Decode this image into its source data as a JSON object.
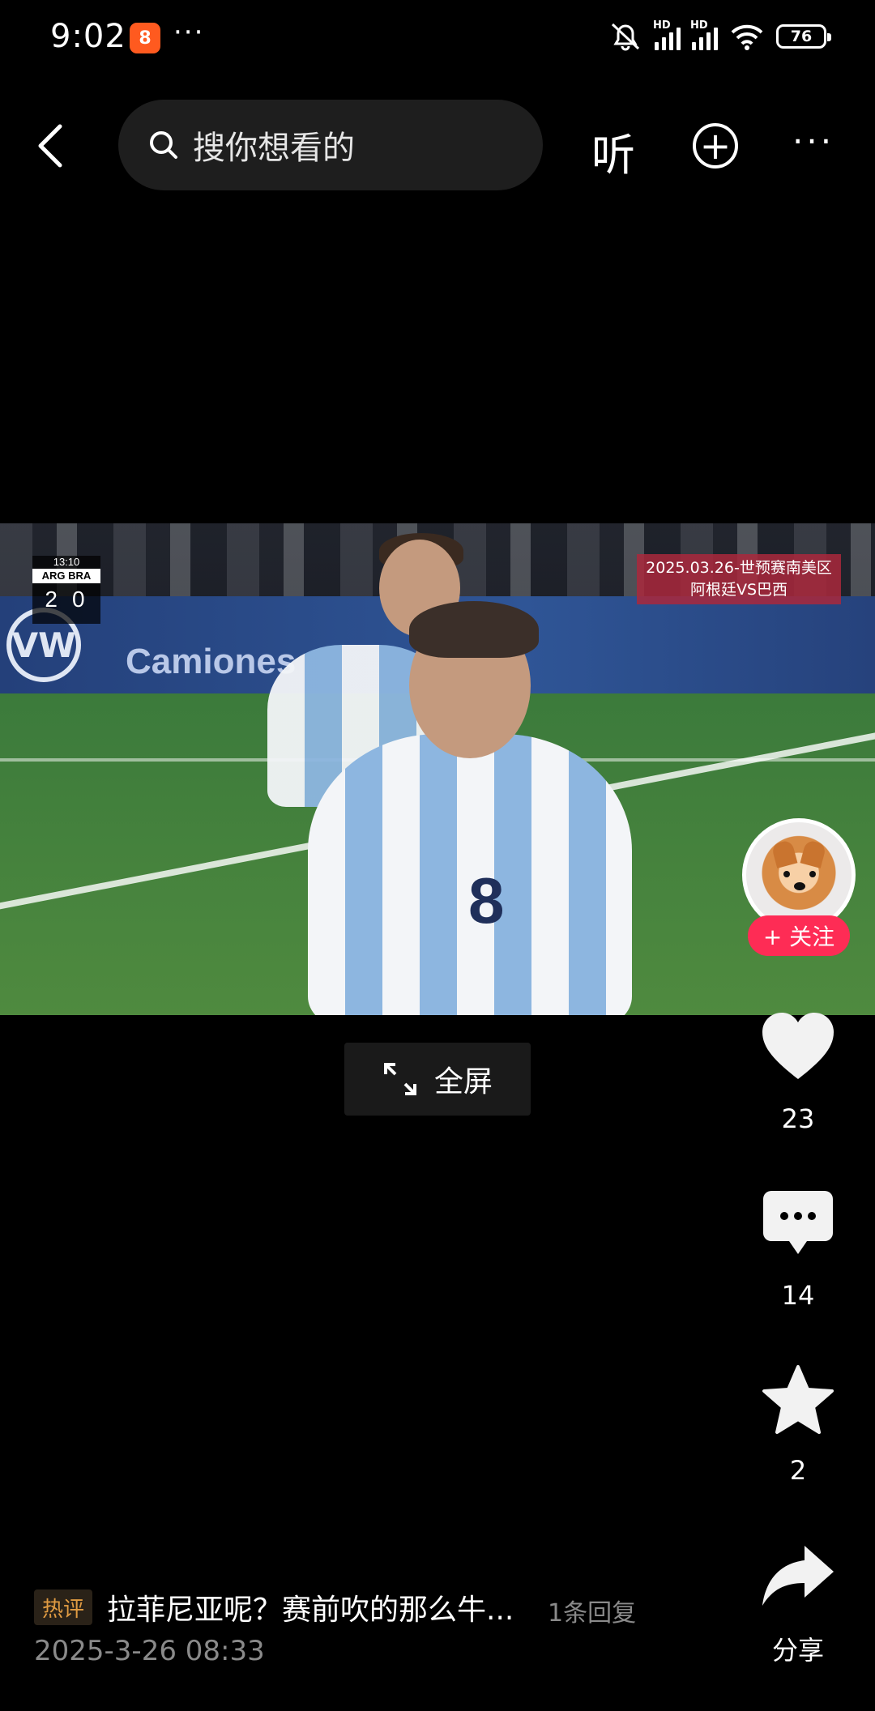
{
  "status_bar": {
    "time": "9:02",
    "app_badge": "8",
    "more": "···",
    "signal_labels": [
      "HD",
      "HD"
    ],
    "battery": "76"
  },
  "top_nav": {
    "search_placeholder": "搜你想看的",
    "listen_label": "听"
  },
  "video": {
    "scoreboard": {
      "clock": "13:10",
      "teams": "ARG BRA",
      "score_home": "2",
      "score_away": "0"
    },
    "match_label_line1": "2025.03.26-世预赛南美区",
    "match_label_line2": "阿根廷VS巴西",
    "ad_text": "Camiones",
    "jersey_number": "8"
  },
  "fullscreen_label": "全屏",
  "right_rail": {
    "follow_label": "+ 关注",
    "likes": "23",
    "comments": "14",
    "favorites": "2",
    "share_label": "分享"
  },
  "comment_bar": {
    "tag": "热评",
    "text": "拉菲尼亚呢？赛前吹的那么牛...",
    "reply_count": "1条回复",
    "date": "2025-3-26 08:33"
  },
  "colors": {
    "follow": "#fe2c55",
    "hot_tag": "#e09b42",
    "muted": "#8a8a8a"
  }
}
